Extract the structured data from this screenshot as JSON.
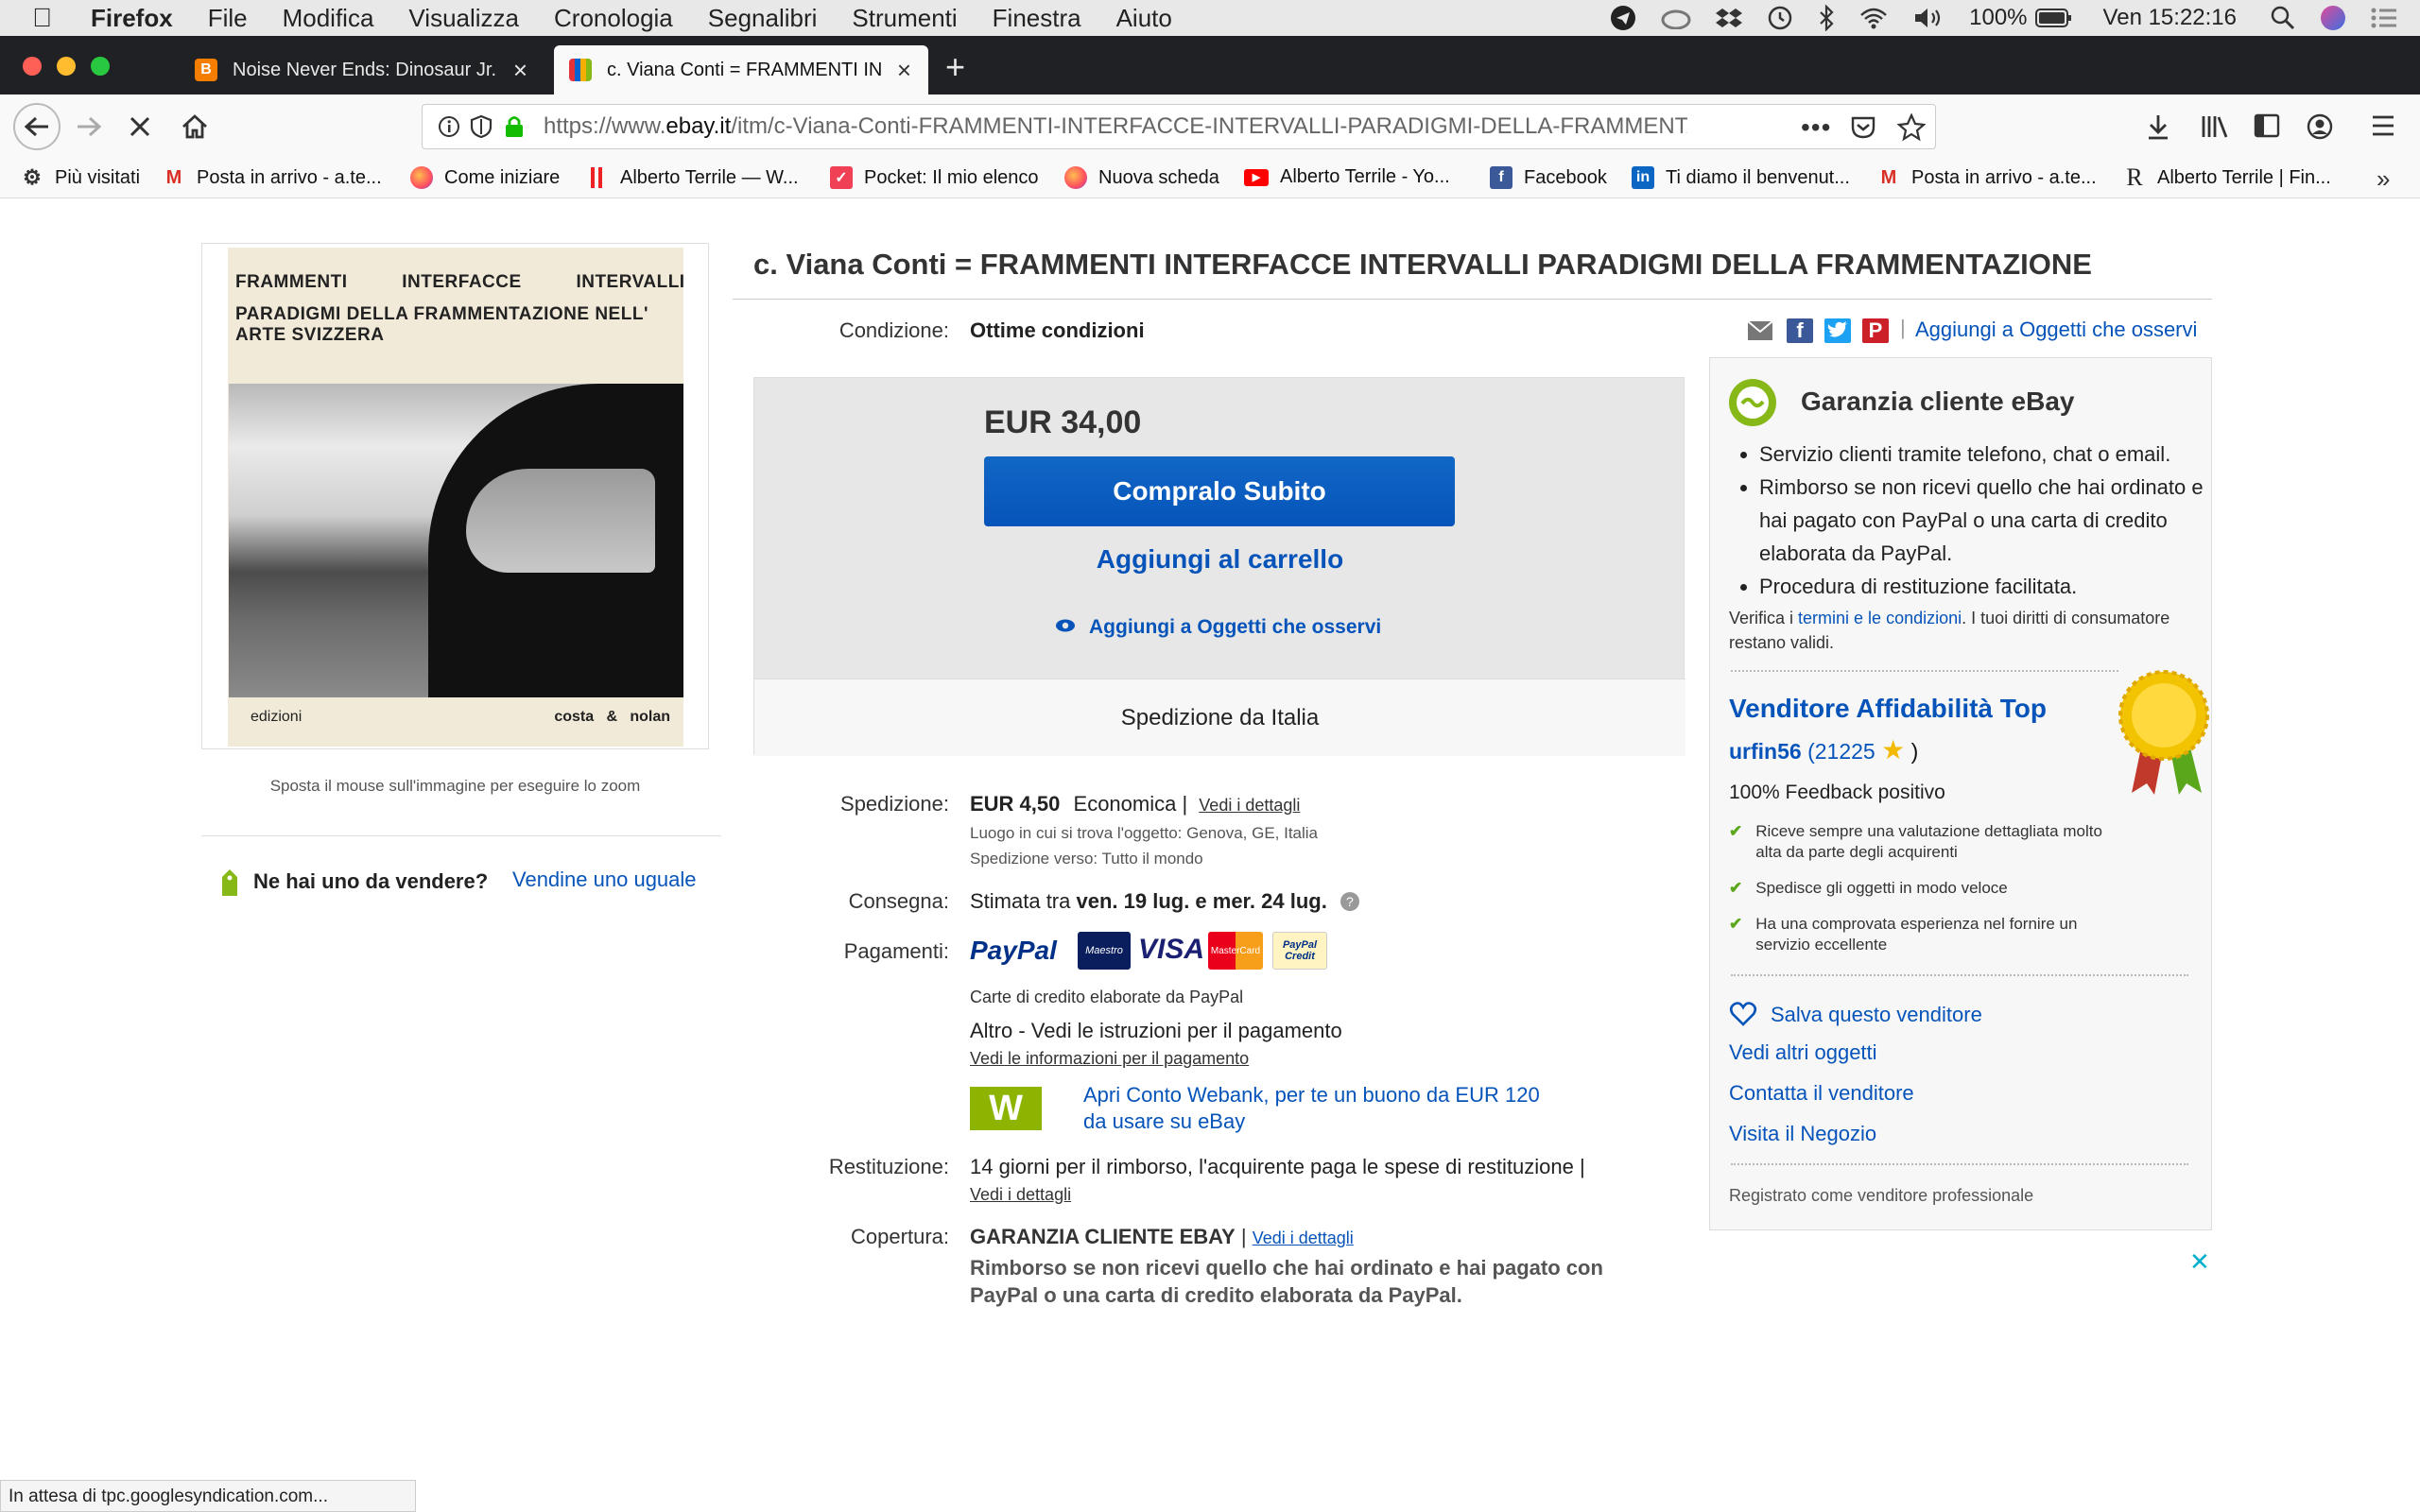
{
  "menubar": {
    "app": "Firefox",
    "items": [
      "File",
      "Modifica",
      "Visualizza",
      "Cronologia",
      "Segnalibri",
      "Strumenti",
      "Finestra",
      "Aiuto"
    ],
    "battery": "100%",
    "clock": "Ven 15:22:16"
  },
  "tabs": [
    {
      "title": "Noise Never Ends: Dinosaur Jr.",
      "favicon": "blogger-icon",
      "color": "#f57d00"
    },
    {
      "title": "c. Viana Conti = FRAMMENTI IN",
      "favicon": "ebay-icon",
      "color": "#e53238"
    }
  ],
  "nav": {
    "url_prefix": "https://www.",
    "url_domain": "ebay.it",
    "url_path": "/itm/c-Viana-Conti-FRAMMENTI-INTERFACCE-INTERVALLI-PARADIGMI-DELLA-FRAMMENTA"
  },
  "bookmarks": [
    {
      "label": "Più visitati",
      "icon": "gear-icon"
    },
    {
      "label": "Posta in arrivo - a.te...",
      "icon": "gmail-icon"
    },
    {
      "label": "Come iniziare",
      "icon": "firefox-icon"
    },
    {
      "label": "Alberto Terrile — W...",
      "icon": "bars-icon"
    },
    {
      "label": "Pocket: Il mio elenco",
      "icon": "pocket-icon"
    },
    {
      "label": "Nuova scheda",
      "icon": "firefox-icon"
    },
    {
      "label": "Alberto Terrile - Yo...",
      "icon": "youtube-icon"
    },
    {
      "label": "Facebook",
      "icon": "facebook-icon"
    },
    {
      "label": "Ti diamo il benvenut...",
      "icon": "linkedin-icon"
    },
    {
      "label": "Posta in arrivo - a.te...",
      "icon": "gmail-icon"
    },
    {
      "label": "Alberto Terrile | Fin...",
      "icon": "r-icon"
    }
  ],
  "product": {
    "title": "c. Viana Conti = FRAMMENTI INTERFACCE INTERVALLI PARADIGMI DELLA FRAMMENTAZIONE",
    "cover_line1": "FRAMMENTI          INTERFACCE          INTERVALLI",
    "cover_line2": "PARADIGMI DELLA FRAMMENTAZIONE NELL' ARTE SVIZZERA",
    "cover_publisher_left": "edizioni",
    "cover_publisher_right": "costa   &   nolan",
    "zoom_hint": "Sposta il mouse sull'immagine per eseguire lo zoom",
    "sell_question": "Ne hai uno da vendere?",
    "sell_link": "Vendine uno uguale"
  },
  "condition": {
    "label": "Condizione:",
    "value": "Ottime condizioni"
  },
  "share": {
    "watch_link": "Aggiungi a Oggetti che osservi"
  },
  "buybox": {
    "price": "EUR 34,00",
    "buy_now": "Compralo Subito",
    "add_cart": "Aggiungi al carrello",
    "watch": "Aggiungi a Oggetti che osservi",
    "ships_from": "Spedizione da Italia"
  },
  "details": {
    "shipping_label": "Spedizione:",
    "shipping_price": "EUR 4,50",
    "shipping_type": "Economica |",
    "shipping_link": "Vedi i dettagli",
    "location": "Luogo in cui si trova l'oggetto:  Genova, GE, Italia",
    "ships_to": "Spedizione verso:  Tutto il mondo",
    "delivery_label": "Consegna:",
    "delivery_prefix": "Stimata tra ",
    "delivery_dates": "ven. 19 lug. e mer. 24 lug.",
    "payments_label": "Pagamenti:",
    "card_note": "Carte di credito elaborate da PayPal",
    "other_pay": "Altro - Vedi le istruzioni per il pagamento",
    "pay_info_link": "Vedi le informazioni per il pagamento",
    "webank_line1": "Apri Conto Webank, per te un buono da EUR 120",
    "webank_line2": "da usare su eBay",
    "returns_label": "Restituzione:",
    "returns_text": "14 giorni per il rimborso, l'acquirente paga le spese di restituzione |",
    "returns_link": "Vedi i dettagli",
    "coverage_label": "Copertura:",
    "coverage_title": "GARANZIA CLIENTE EBAY",
    "coverage_link": "Vedi i dettagli",
    "coverage_text1": "Rimborso se non ricevi quello che hai ordinato e hai pagato con",
    "coverage_text2": "PayPal o una carta di credito elaborata da PayPal."
  },
  "payment_logos": [
    "PayPal",
    "Maestro",
    "VISA",
    "MasterCard",
    "PayPal Credit"
  ],
  "guarantee": {
    "title": "Garanzia cliente eBay",
    "bullets": [
      "Servizio clienti tramite telefono, chat o email.",
      "Rimborso se non ricevi quello che hai ordinato e hai pagato con PayPal o una carta di credito elaborata da PayPal.",
      "Procedura di restituzione facilitata."
    ],
    "terms_prefix": "Verifica i ",
    "terms_link": "termini e le condizioni",
    "terms_suffix": ". I tuoi diritti di consumatore restano validi."
  },
  "seller": {
    "top_rated": "Venditore Affidabilità Top",
    "name": "urfin56",
    "score": "21225",
    "feedback": "100% Feedback positivo",
    "perks": [
      "Riceve sempre una valutazione dettagliata molto alta da parte degli acquirenti",
      "Spedisce gli oggetti in modo veloce",
      "Ha una comprovata esperienza nel fornire un servizio eccellente"
    ],
    "save": "Salva questo venditore",
    "other_items": "Vedi altri oggetti",
    "contact": "Contatta il venditore",
    "store": "Visita il Negozio",
    "registered": "Registrato come venditore professionale"
  },
  "statusbar": {
    "text": "In attesa di tpc.googlesyndication.com..."
  },
  "colors": {
    "ebay_blue": "#0654ba",
    "check_green": "#5ba71b",
    "buy_now": "#0654ba"
  }
}
